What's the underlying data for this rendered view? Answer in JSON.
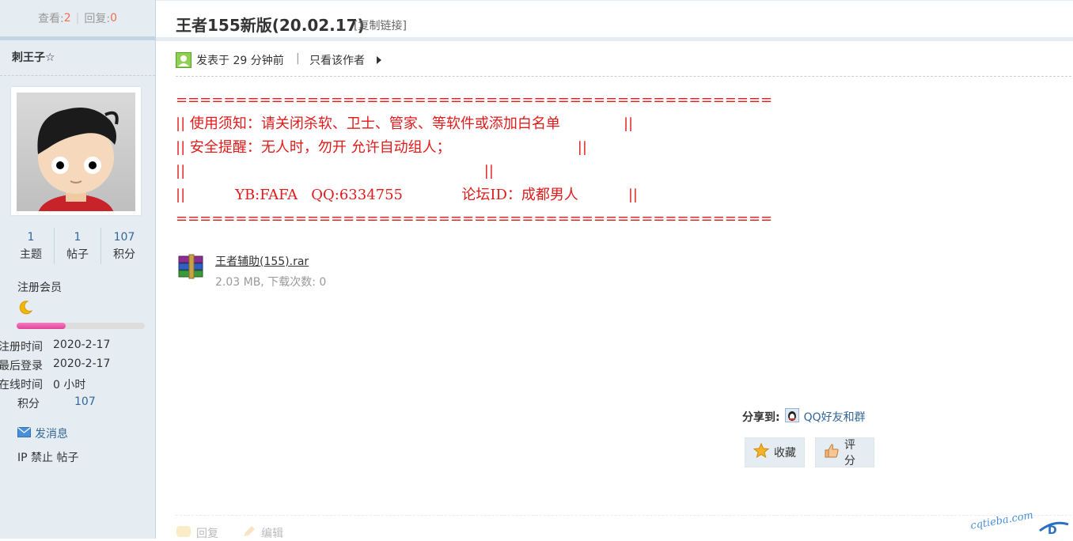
{
  "sidebar": {
    "views_label": "查看:",
    "views": "2",
    "sep": "|",
    "replies_label": "回复:",
    "replies": "0",
    "author": "刺王子☆",
    "stats": [
      {
        "value": "1",
        "label": "主题"
      },
      {
        "value": "1",
        "label": "帖子"
      },
      {
        "value": "107",
        "label": "积分"
      }
    ],
    "group": "注册会员",
    "progress": 0.38,
    "info": [
      {
        "label": "注册时间",
        "value": "2020-2-17"
      },
      {
        "label": "最后登录",
        "value": "2020-2-17"
      },
      {
        "label": "在线时间",
        "value": "0 小时"
      }
    ],
    "points_label": "积分",
    "points_value": "107",
    "send_message": "发消息",
    "ban_text": "IP 禁止 帖子"
  },
  "post": {
    "title": "王者155新版(20.02.17)",
    "copy_link": "[复制链接]",
    "posted": "发表于 29 分钟前",
    "pipe": "|",
    "only_author": "只看该作者",
    "content_lines": [
      "==================================================",
      "|| 使用须知：请关闭杀软、卫士、管家、等软件或添加白名单              ||",
      "|| 安全提醒：无人时，勿开 允许自动组人；                            ||",
      "||                                                                  ||",
      "||           YB:FAFA   QQ:6334755             论坛ID：成都男人           ||",
      "=================================================="
    ],
    "attachment": {
      "name": "王者辅助(155).rar",
      "info": "2.03 MB, 下载次数: 0"
    },
    "share_label": "分享到:",
    "share_target": "QQ好友和群",
    "favorite": "收藏",
    "rate": "评分",
    "reply": "回复",
    "edit": "编辑"
  },
  "watermark": "cqtieba.com",
  "colors": {
    "sidebar_bg": "#e5edf2",
    "link_blue": "#336699",
    "content_red": "#e01a1a",
    "count_orange": "#f26c4f"
  }
}
